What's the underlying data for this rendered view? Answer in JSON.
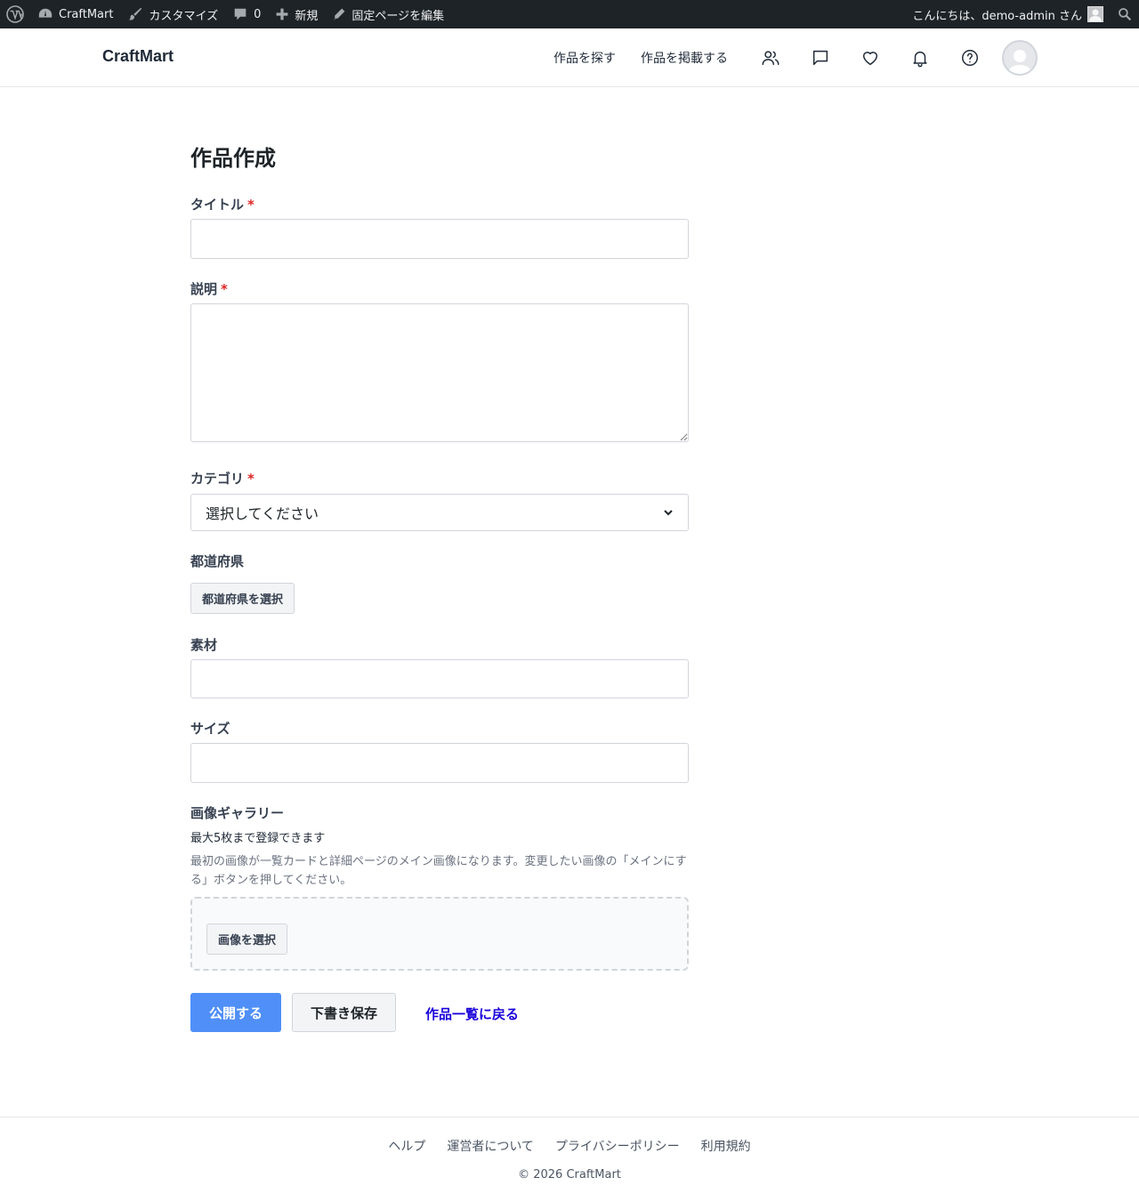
{
  "admin_bar": {
    "site_name": "CraftMart",
    "customize": "カスタマイズ",
    "comments_count": "0",
    "new": "新規",
    "edit_page": "固定ページを編集",
    "greeting": "こんにちは、demo-admin さん"
  },
  "header": {
    "logo": "CraftMart",
    "nav": {
      "browse": "作品を探す",
      "post": "作品を掲載する"
    },
    "icons": [
      "users-icon",
      "message-icon",
      "heart-icon",
      "bell-icon",
      "help-icon"
    ]
  },
  "form": {
    "title": "作品作成",
    "required_mark": "*",
    "title_label": "タイトル",
    "title_value": "",
    "description_label": "説明",
    "description_value": "",
    "category_label": "カテゴリ",
    "category_selected": "選択してください",
    "prefecture_label": "都道府県",
    "prefecture_button": "都道府県を選択",
    "material_label": "素材",
    "material_value": "",
    "size_label": "サイズ",
    "size_value": "",
    "gallery_label": "画像ギャラリー",
    "gallery_limit": "最大5枚まで登録できます",
    "gallery_help": "最初の画像が一覧カードと詳細ページのメイン画像になります。変更したい画像の「メインにする」ボタンを押してください。",
    "gallery_button": "画像を選択",
    "publish_button": "公開する",
    "draft_button": "下書き保存",
    "back_link": "作品一覧に戻る"
  },
  "footer": {
    "links": [
      "ヘルプ",
      "運営者について",
      "プライバシーポリシー",
      "利用規約"
    ],
    "copyright": "© 2026 CraftMart"
  },
  "colors": {
    "admin_bar_bg": "#1d2327",
    "primary_button": "#4f8ff7",
    "link": "#1a00d9",
    "required": "#dc2626"
  }
}
